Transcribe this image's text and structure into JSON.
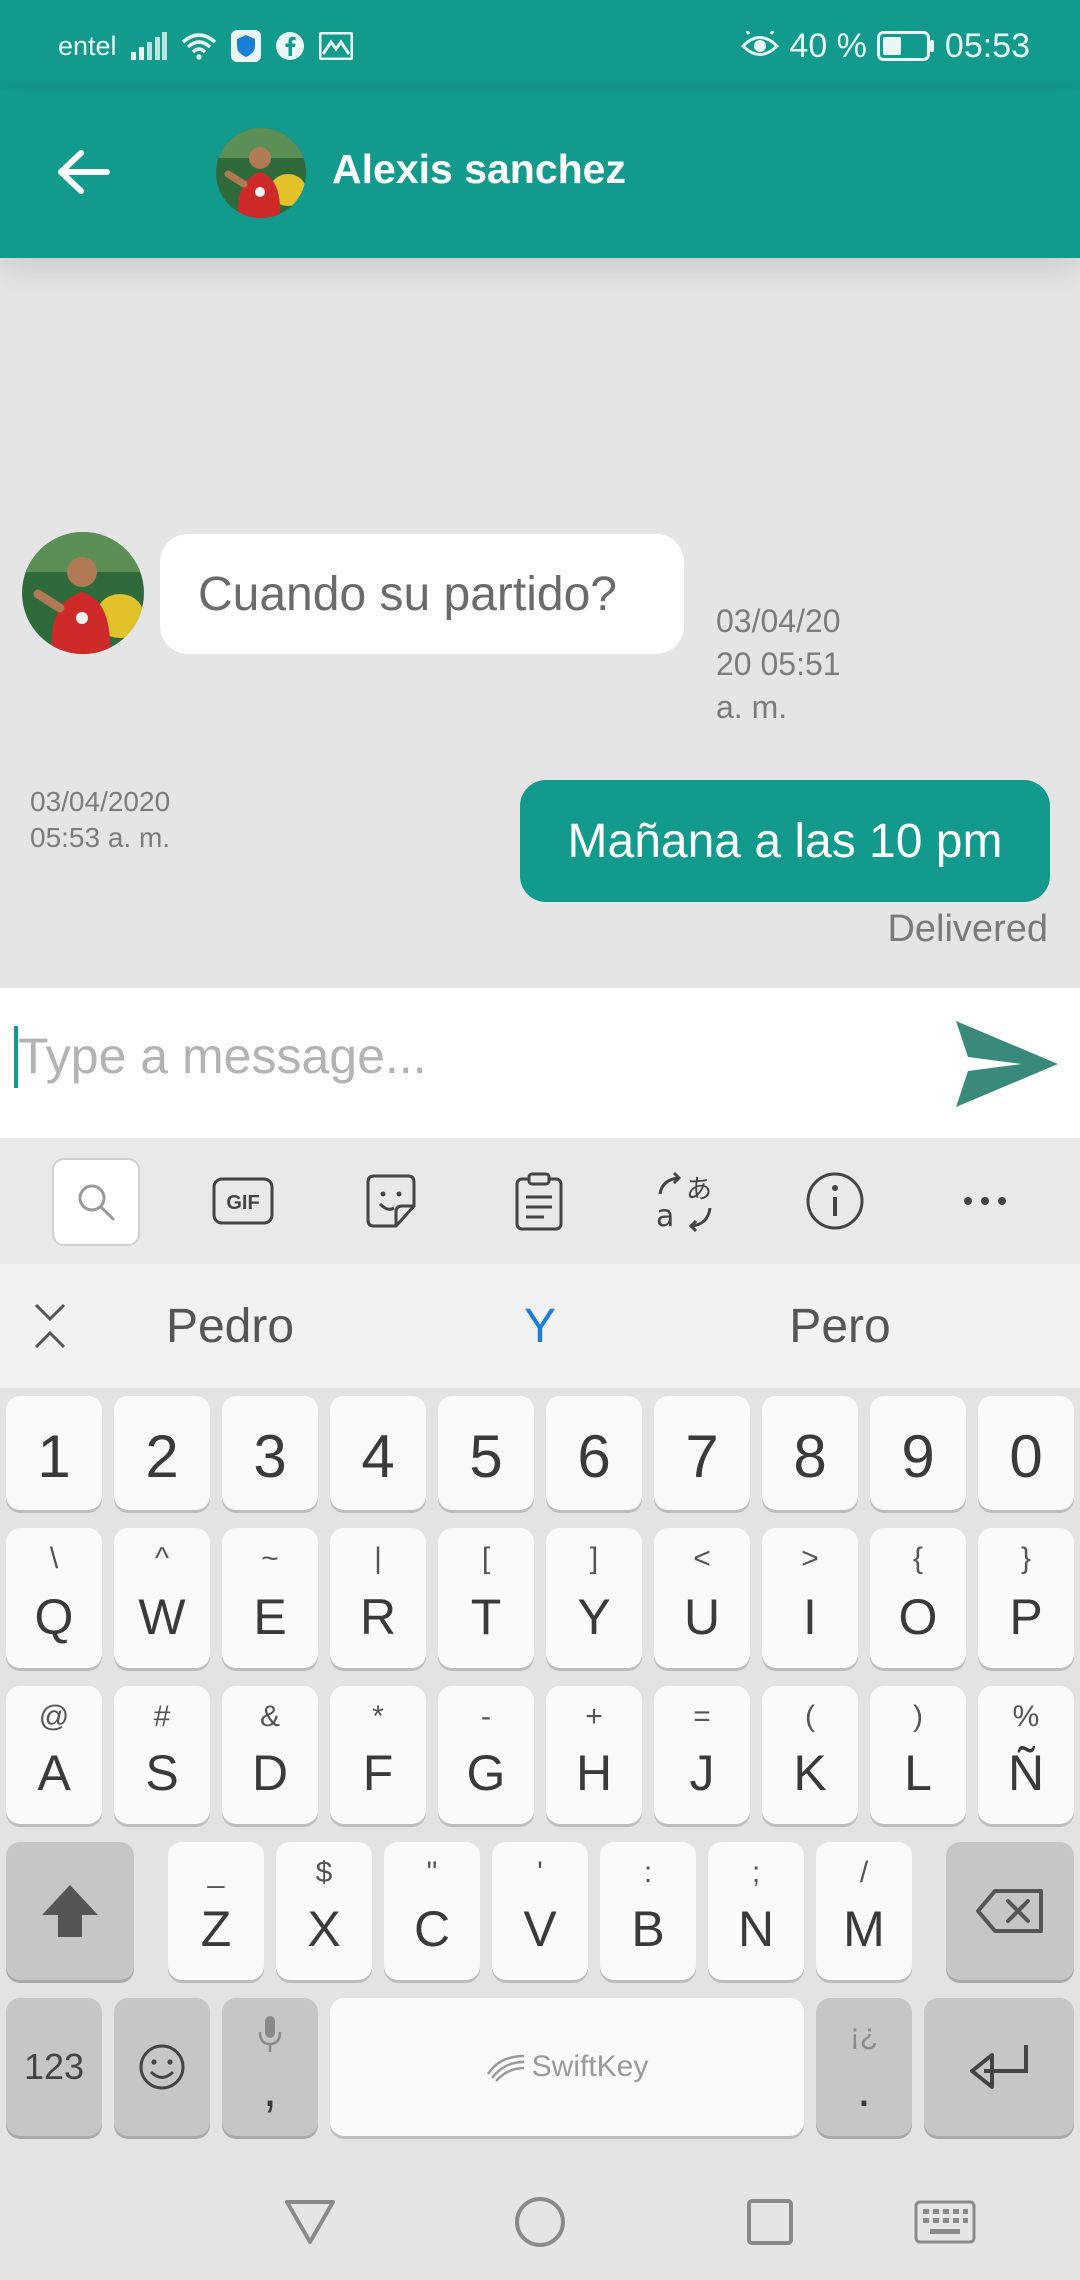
{
  "status_bar": {
    "carrier": "entel",
    "battery": "40 %",
    "time": "05:53",
    "icons": [
      "signal-icon",
      "wifi-icon",
      "shield-icon",
      "facebook-icon",
      "mail-icon",
      "eye-icon",
      "battery-icon"
    ]
  },
  "app_bar": {
    "title": "Alexis sanchez",
    "icons": [
      "back-arrow-icon",
      "avatar"
    ]
  },
  "colors": {
    "primary": "#129a8c",
    "background": "#e5e5e5",
    "suggestion_highlight": "#1a7fd6"
  },
  "messages": [
    {
      "direction": "incoming",
      "text": "Cuando su partido?",
      "time_line1": "03/04/20",
      "time_line2": "20 05:51",
      "time_line3": "a. m."
    },
    {
      "direction": "outgoing",
      "text": "Mañana a las 10 pm",
      "time_line1": "03/04/2020",
      "time_line2": "05:53 a. m.",
      "status": "Delivered"
    }
  ],
  "input": {
    "placeholder": "Type a message...",
    "value": ""
  },
  "keyboard": {
    "toolbar_icons": [
      "search-icon",
      "gif-icon",
      "sticker-icon",
      "clipboard-icon",
      "translate-icon",
      "info-icon",
      "more-icon"
    ],
    "gif_label": "GIF",
    "suggestions": [
      "Pedro",
      "Y",
      "Pero"
    ],
    "number_row": [
      "1",
      "2",
      "3",
      "4",
      "5",
      "6",
      "7",
      "8",
      "9",
      "0"
    ],
    "row1": {
      "main": [
        "Q",
        "W",
        "E",
        "R",
        "T",
        "Y",
        "U",
        "I",
        "O",
        "P"
      ],
      "sub": [
        "\\",
        "^",
        "~",
        "|",
        "[",
        "]",
        "<",
        ">",
        "{",
        "}"
      ]
    },
    "row2": {
      "main": [
        "A",
        "S",
        "D",
        "F",
        "G",
        "H",
        "J",
        "K",
        "L",
        "Ñ"
      ],
      "sub": [
        "@",
        "#",
        "&",
        "*",
        "-",
        "+",
        "=",
        "(",
        ")",
        "%"
      ]
    },
    "row3": {
      "main": [
        "Z",
        "X",
        "C",
        "V",
        "B",
        "N",
        "M"
      ],
      "sub": [
        "_",
        "$",
        "\"",
        "'",
        ":",
        ";",
        "/"
      ]
    },
    "bottom": {
      "numbers_key": "123",
      "comma": ",",
      "space_brand": "SwiftKey",
      "period": ".",
      "period_sub": "¡¿"
    }
  },
  "nav_bar": {
    "icons": [
      "back-triangle-icon",
      "home-circle-icon",
      "recents-square-icon",
      "keyboard-icon"
    ]
  }
}
